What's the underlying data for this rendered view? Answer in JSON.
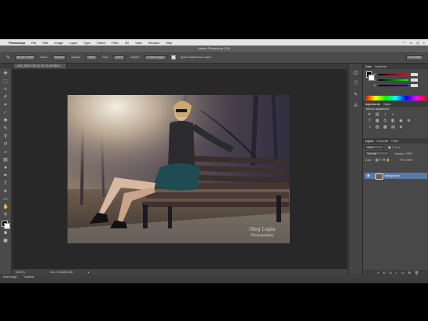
{
  "menubar": {
    "app_name": "Photoshop",
    "items": [
      "File",
      "Edit",
      "Image",
      "Layer",
      "Type",
      "Select",
      "Filter",
      "3D",
      "View",
      "Window",
      "Help"
    ],
    "status_icons": [
      "wifi-icon",
      "battery-icon",
      "clock-icon",
      "search-icon"
    ]
  },
  "window": {
    "title": "Adobe Photoshop CS6"
  },
  "options": {
    "preset": "Brush Preset",
    "mode_label": "Mode:",
    "mode_value": "Normal",
    "opacity_label": "Opacity:",
    "opacity_value": "100%",
    "flow_label": "Flow:",
    "flow_value": "100%",
    "sample_label": "Sample:",
    "sample_value": "Current Layer",
    "checkbox_label": "Ignore Adjustment Layers",
    "workspace": "Essentials"
  },
  "document": {
    "tab_title": "IMG_8533.CR2 @ 16.7% (RGB/8*)"
  },
  "tools": [
    "move",
    "marquee",
    "lasso",
    "quick-select",
    "crop",
    "eyedropper",
    "healing",
    "brush",
    "clone",
    "history-brush",
    "eraser",
    "gradient",
    "dodge",
    "pen",
    "type",
    "path-select",
    "shape",
    "hand",
    "zoom"
  ],
  "status": {
    "zoom": "16.67%",
    "doc_info": "Doc: 61.8M/61.8M"
  },
  "bottom_tabs": [
    "Mini Bridge",
    "Timeline"
  ],
  "colors": {
    "ui_dark": "#3b3b3b",
    "panel": "#484848",
    "layer_selected": "#5a7aa6",
    "foreground": "#000000",
    "background": "#ffffff"
  },
  "panels": {
    "color_tabs": [
      "Color",
      "Swatches"
    ],
    "color_channels": [
      "R",
      "G",
      "B"
    ],
    "adjust_tabs": [
      "Adjustments",
      "Styles"
    ],
    "adjust_title": "Add an adjustment",
    "layer_tabs": [
      "Layers",
      "Channels",
      "Paths"
    ],
    "kind_label": "Kind",
    "blend_mode": "Normal",
    "opacity_label": "Opacity: 100%",
    "lock_label": "Lock:",
    "fill_label": "Fill: 100%",
    "layer_name": "Background"
  },
  "photo": {
    "watermark_line1": "Oleg Lopin",
    "watermark_line2": "Photography"
  }
}
